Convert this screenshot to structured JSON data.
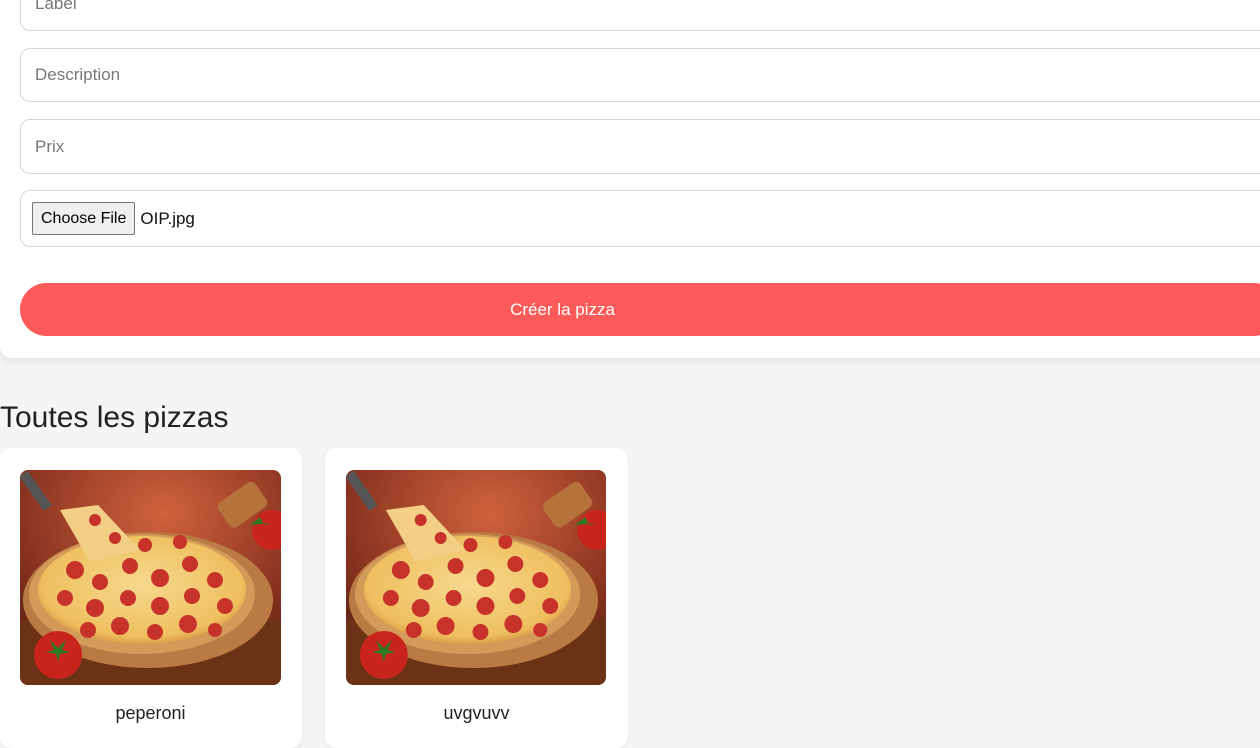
{
  "form": {
    "label_placeholder": "Label",
    "description_placeholder": "Description",
    "price_placeholder": "Prix",
    "file_button_label": "Choose File",
    "file_name": "OIP.jpg",
    "submit_label": "Créer la pizza"
  },
  "list": {
    "title": "Toutes les pizzas",
    "pizzas": [
      {
        "name": "peperoni"
      },
      {
        "name": "uvgvuvv"
      }
    ]
  },
  "colors": {
    "accent": "#fd5b59",
    "background": "#f5f5f5",
    "card": "#ffffff"
  }
}
